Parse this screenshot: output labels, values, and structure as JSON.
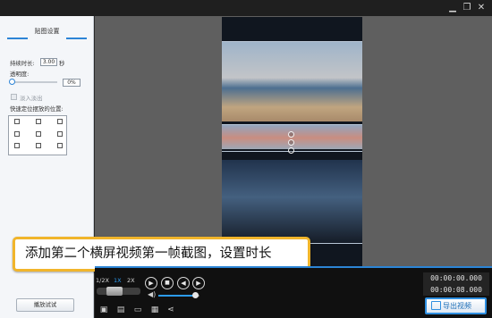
{
  "window": {
    "buttons": {
      "minimize": "▁",
      "restore": "❐",
      "close": "✕"
    }
  },
  "left_panel": {
    "title": "贴图设置",
    "duration_label": "持续时长:",
    "duration_value": "3.00",
    "duration_unit": "秒",
    "opacity_label": "透明度:",
    "opacity_value": "0%",
    "opacity_level": 0,
    "fade_label": "淡入淡出",
    "fade_checked": false,
    "position_label": "快速定位摆放的位置:",
    "preview_button": "播放试试"
  },
  "preview": {
    "caption": "添加第二个横屏视频第一帧截图，设置时长"
  },
  "playback": {
    "speeds": [
      "1/2X",
      "1X",
      "2X"
    ],
    "active_speed": "1X",
    "play_icon": "▶",
    "stop_icon": "■",
    "prev_icon": "◀",
    "next_icon": "▶",
    "volume_icon": "◀)",
    "volume_level": 0.9,
    "current_time": "00:00:00.000",
    "total_time": "00:00:08.000",
    "export_label": "导出视频"
  },
  "colors": {
    "accent": "#2c85d6",
    "caption_border": "#f1b52b"
  }
}
